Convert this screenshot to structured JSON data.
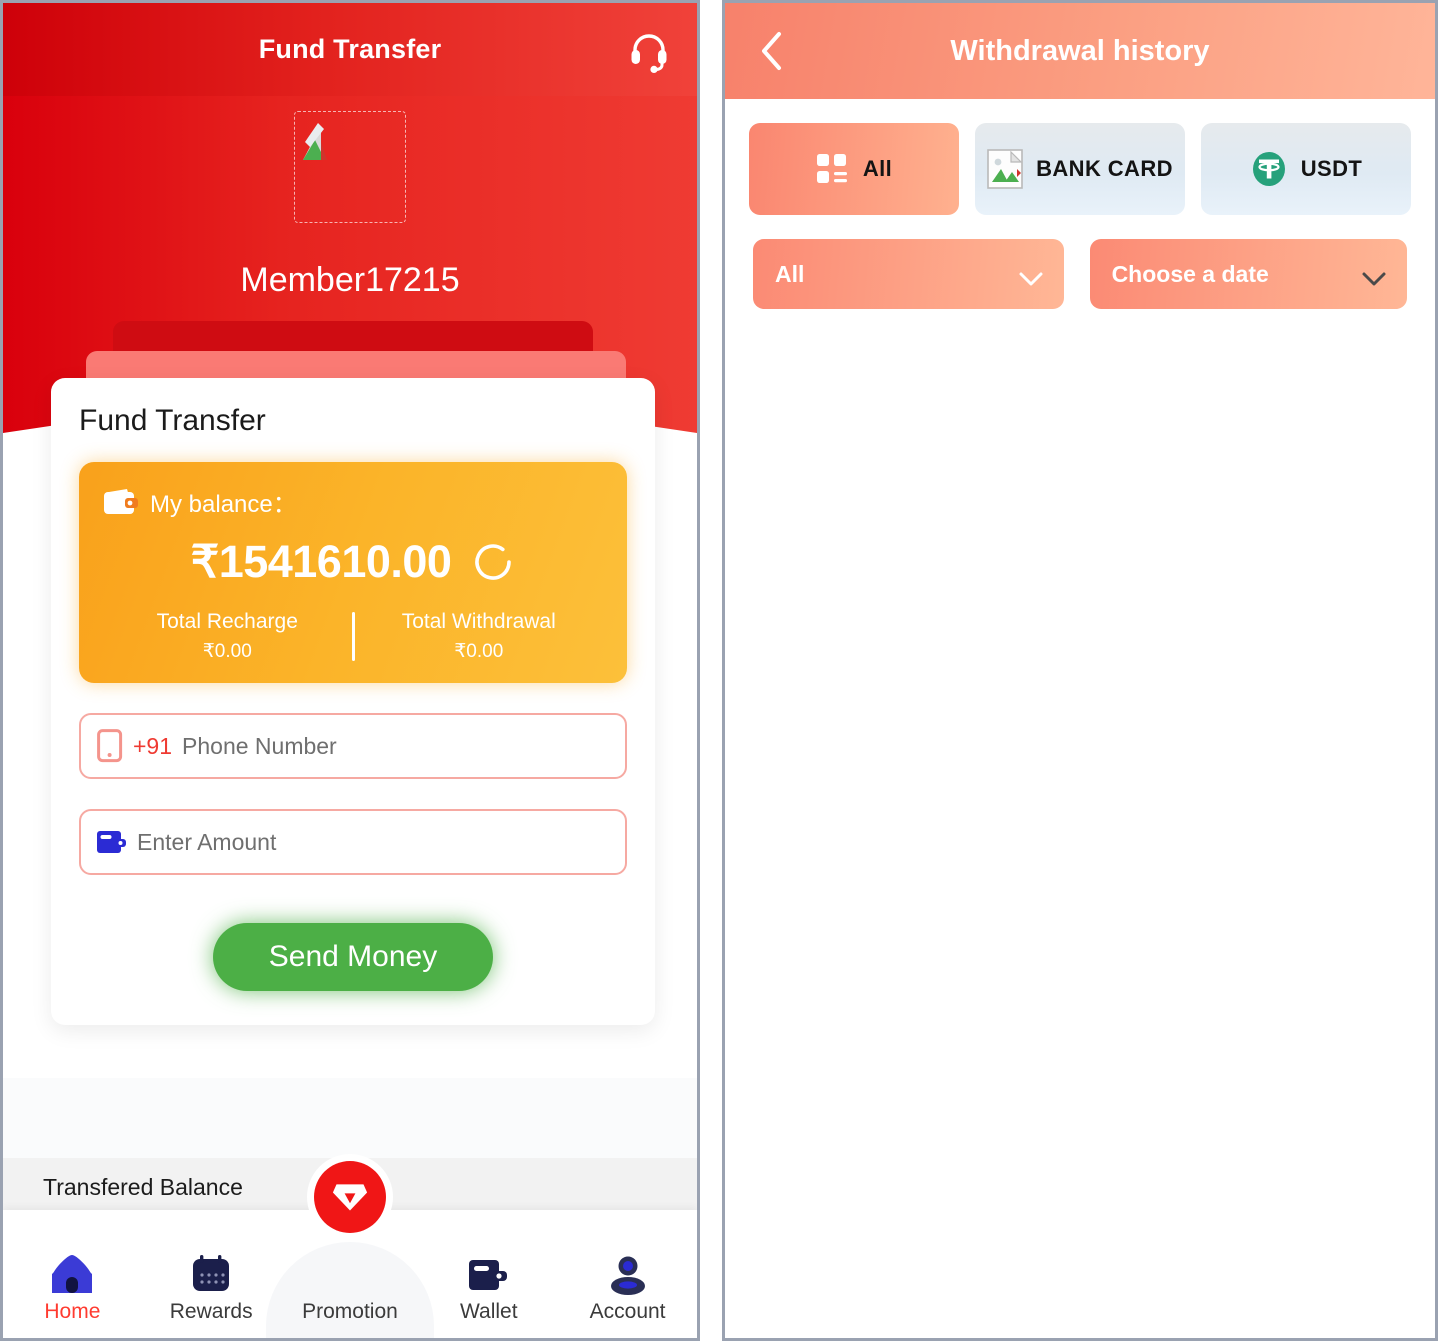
{
  "left": {
    "topbar": {
      "title": "Fund Transfer",
      "support_icon": "headset-icon"
    },
    "profile": {
      "username": "Member17215",
      "avatar_icon": "broken-image-icon"
    },
    "card": {
      "title": "Fund Transfer",
      "balance": {
        "wallet_icon": "wallet-icon",
        "label": "My balance：",
        "amount": "₹1541610.00",
        "refresh_icon": "refresh-icon",
        "total_recharge_label": "Total Recharge",
        "total_recharge_value": "₹0.00",
        "total_withdrawal_label": "Total Withdrawal",
        "total_withdrawal_value": "₹0.00"
      },
      "phone": {
        "icon": "phone-icon",
        "country_code": "+91",
        "placeholder": "Phone Number",
        "value": ""
      },
      "amount": {
        "icon": "wallet-icon",
        "placeholder": "Enter Amount",
        "value": ""
      },
      "send_label": "Send Money"
    },
    "transfered_balance_label": "Transfered Balance",
    "nav": [
      {
        "label": "Home",
        "icon": "home-icon",
        "active": true
      },
      {
        "label": "Rewards",
        "icon": "calendar-icon",
        "active": false
      },
      {
        "label": "Promotion",
        "icon": "diamond-badge-icon",
        "active": false
      },
      {
        "label": "Wallet",
        "icon": "wallet-icon",
        "active": false
      },
      {
        "label": "Account",
        "icon": "person-icon",
        "active": false
      }
    ]
  },
  "right": {
    "header": {
      "title": "Withdrawal history",
      "back_icon": "chevron-left-icon"
    },
    "tabs": [
      {
        "label": "All",
        "icon": "grid-icon",
        "selected": true
      },
      {
        "label": "BANK CARD",
        "icon": "broken-image-icon",
        "selected": false
      },
      {
        "label": "USDT",
        "icon": "tether-icon",
        "selected": false
      }
    ],
    "filters": [
      {
        "label": "All",
        "icon": "chevron-down-icon"
      },
      {
        "label": "Choose a date",
        "icon": "chevron-down-icon"
      }
    ],
    "list_items": []
  },
  "colors": {
    "brand_red": "#e6231f",
    "header_red_dark": "#ce0009",
    "accent_orange": "#fbb429",
    "send_green": "#4caf46",
    "salmon": "#fb9f82",
    "active_nav": "#ff3b30",
    "nav_icon_blue": "#3b3bd6",
    "nav_icon_navy": "#1b1f4b",
    "usdt_green": "#26a17b"
  }
}
